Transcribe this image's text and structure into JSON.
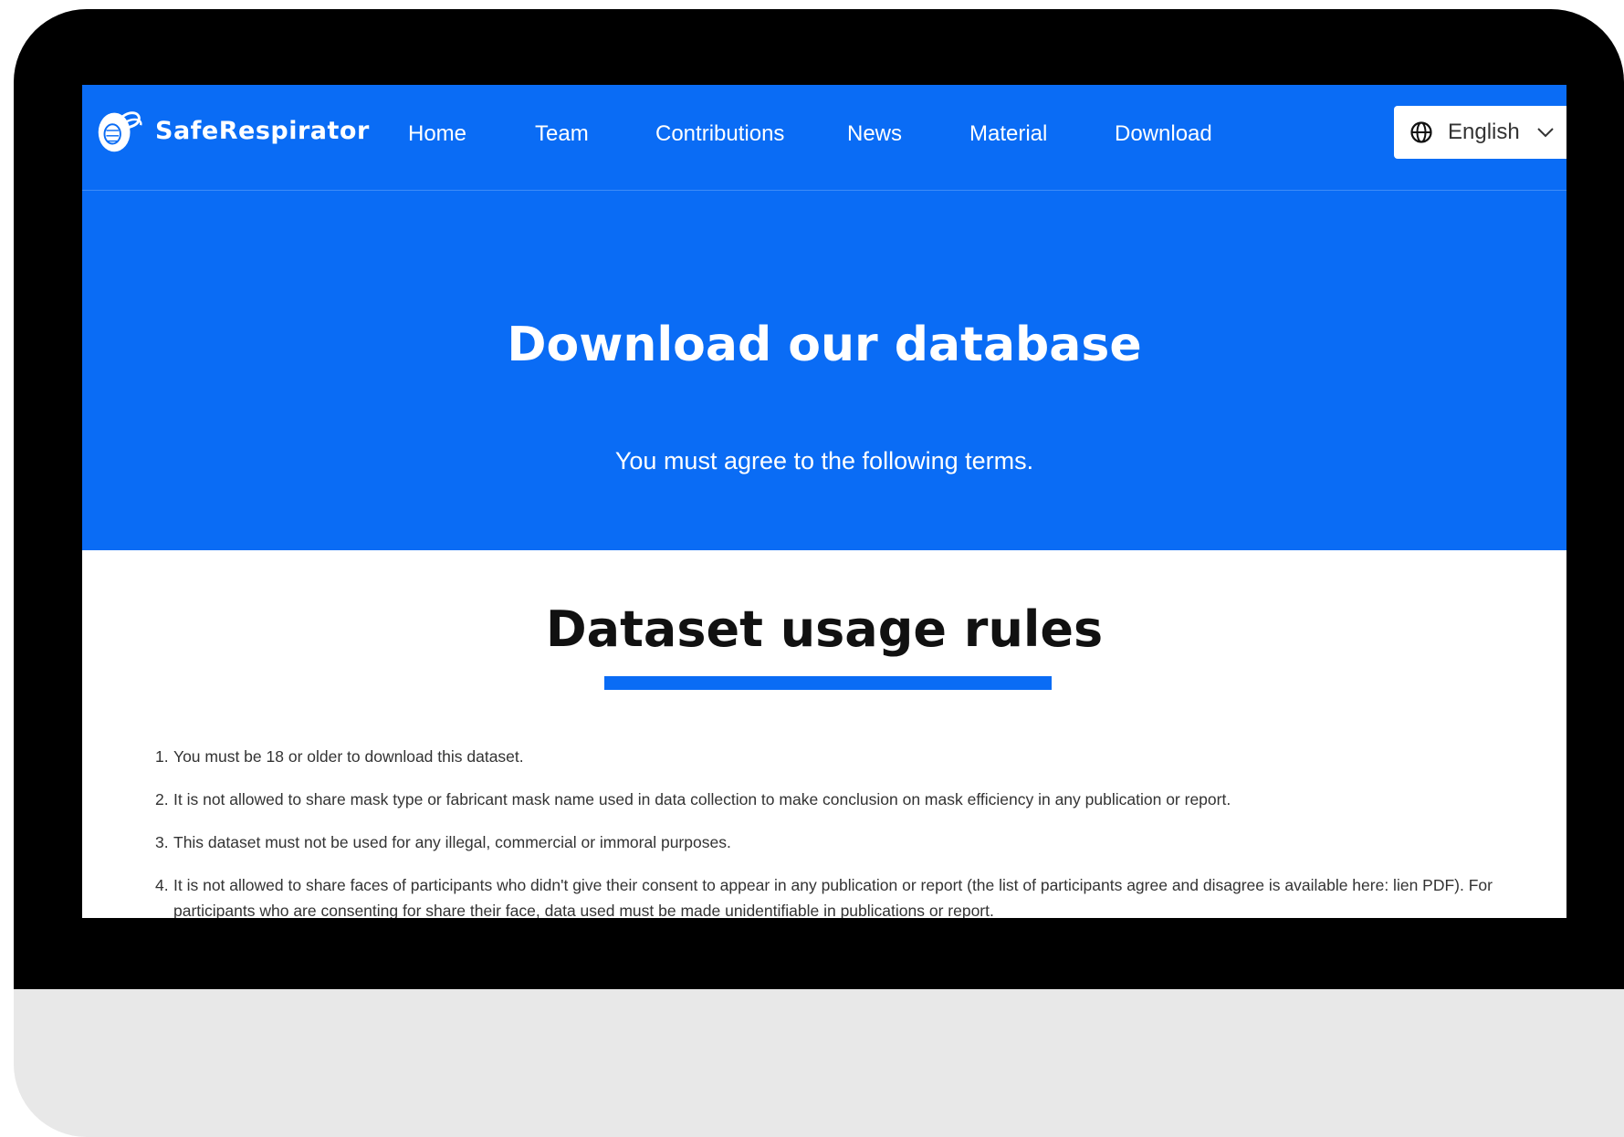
{
  "brand": {
    "name": "SafeRespirator",
    "primary_color": "#0a6cf5",
    "logo_icon": "respirator-mask-icon"
  },
  "nav": {
    "items": [
      {
        "label": "Home"
      },
      {
        "label": "Team"
      },
      {
        "label": "Contributions"
      },
      {
        "label": "News"
      },
      {
        "label": "Material"
      },
      {
        "label": "Download"
      }
    ],
    "language": {
      "selected": "English",
      "icon": "globe-icon",
      "dropdown_icon": "chevron-down-icon"
    }
  },
  "hero": {
    "title": "Download our database",
    "subtitle": "You must agree to the following terms."
  },
  "rules": {
    "title": "Dataset usage rules",
    "items": [
      {
        "number": "1.",
        "text": "You must be 18 or older to download this dataset."
      },
      {
        "number": "2.",
        "text": "It is not allowed to share mask type or fabricant mask name used in data collection to make conclusion on mask efficiency in any publication or report."
      },
      {
        "number": "3.",
        "text": "This dataset must not be used for any illegal, commercial or immoral purposes."
      },
      {
        "number": "4.",
        "text": "It is not allowed to share faces of participants who didn't give their consent to appear in any publication or report (the list of participants agree and disagree is available here: lien PDF). For participants who are consenting for share their face, data used must be made unidentifiable in publications or report."
      }
    ]
  }
}
